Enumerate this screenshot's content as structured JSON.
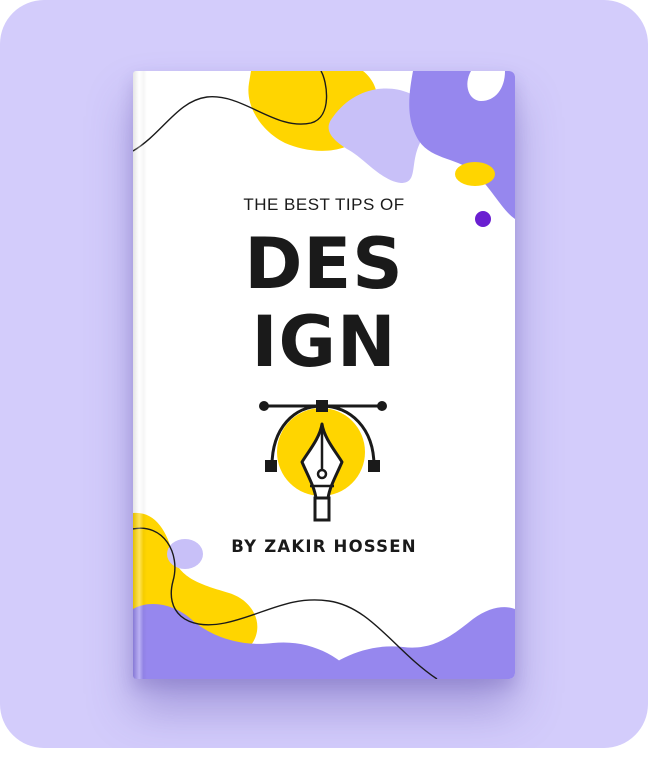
{
  "cover": {
    "subtitle": "THE BEST TIPS OF",
    "title_line_1": "DES",
    "title_line_2": "IGN",
    "author": "BY ZAKIR HOSSEN"
  },
  "colors": {
    "background": "#d3ccfb",
    "yellow": "#ffd500",
    "purple": "#9687ee",
    "lavender": "#c8c0f8",
    "dot": "#6a1fd1",
    "ink": "#1a1a1a"
  },
  "icons": {
    "cover_emblem": "pen-tool-icon"
  }
}
